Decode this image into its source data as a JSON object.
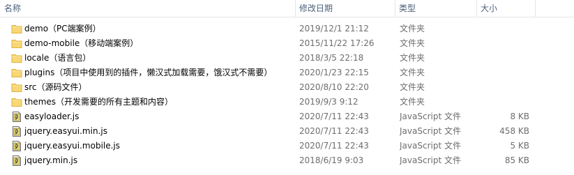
{
  "columns": {
    "name": "名称",
    "date": "修改日期",
    "type": "类型",
    "size": "大小"
  },
  "files": [
    {
      "name": "demo（PC端案例）",
      "date": "2019/12/1 21:12",
      "type": "文件夹",
      "size": "",
      "icon": "folder-icon"
    },
    {
      "name": "demo-mobile（移动端案例）",
      "date": "2015/11/22 17:26",
      "type": "文件夹",
      "size": "",
      "icon": "folder-icon"
    },
    {
      "name": "locale（语言包）",
      "date": "2018/3/5 22:18",
      "type": "文件夹",
      "size": "",
      "icon": "folder-icon"
    },
    {
      "name": "plugins（项目中使用到的插件，懒汉式加载需要，饿汉式不需要）",
      "date": "2020/1/23 22:15",
      "type": "文件夹",
      "size": "",
      "icon": "folder-icon"
    },
    {
      "name": "src（源码文件）",
      "date": "2020/8/10 22:20",
      "type": "文件夹",
      "size": "",
      "icon": "folder-icon"
    },
    {
      "name": "themes（开发需要的所有主题和内容）",
      "date": "2019/9/3 9:12",
      "type": "文件夹",
      "size": "",
      "icon": "folder-icon"
    },
    {
      "name": "easyloader.js",
      "date": "2020/7/11 22:43",
      "type": "JavaScript 文件",
      "size": "8 KB",
      "icon": "js-file-icon"
    },
    {
      "name": "jquery.easyui.min.js",
      "date": "2020/7/11 22:43",
      "type": "JavaScript 文件",
      "size": "458 KB",
      "icon": "js-file-icon"
    },
    {
      "name": "jquery.easyui.mobile.js",
      "date": "2020/7/11 22:43",
      "type": "JavaScript 文件",
      "size": "5 KB",
      "icon": "js-file-icon"
    },
    {
      "name": "jquery.min.js",
      "date": "2018/6/19 9:03",
      "type": "JavaScript 文件",
      "size": "85 KB",
      "icon": "js-file-icon"
    }
  ],
  "colors": {
    "folder": "#f8d775",
    "folder_edge": "#e0b13c",
    "header_text": "#4c607a",
    "detail_text": "#6d6d6d"
  }
}
